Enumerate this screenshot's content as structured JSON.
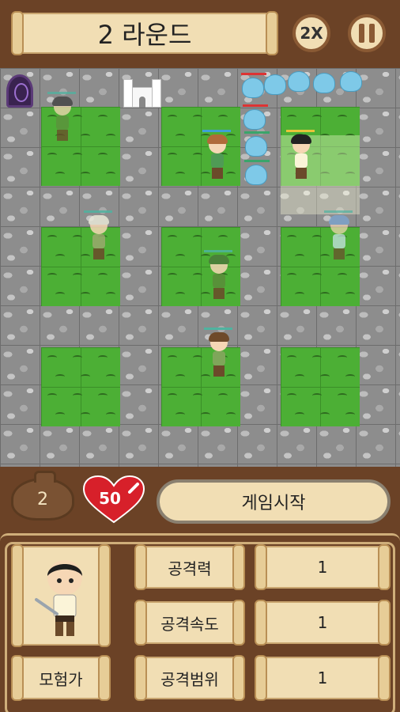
{
  "header": {
    "round_title": "2 라운드",
    "speed_label": "2X",
    "pause_icon": "pause-icon"
  },
  "status": {
    "gold": "2",
    "lives": "50"
  },
  "actions": {
    "start_label": "게임시작"
  },
  "unit_info": {
    "unit_name": "모험가",
    "stats": [
      {
        "label": "공격력",
        "value": "1"
      },
      {
        "label": "공격속도",
        "value": "1"
      },
      {
        "label": "공격범위",
        "value": "1"
      }
    ]
  },
  "colors": {
    "wood": "#6b4226",
    "parchment": "#f1deb4",
    "grass": "#4caf35",
    "stone": "#8d8d8d",
    "heart": "#d7202a"
  }
}
